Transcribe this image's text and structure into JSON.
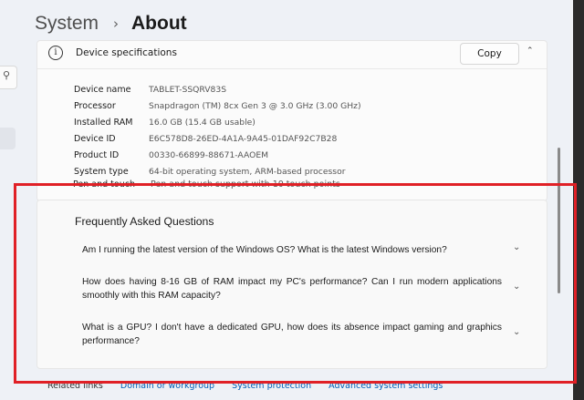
{
  "breadcrumb": {
    "parent": "System",
    "separator": "›",
    "current": "About"
  },
  "sidebar": {
    "search_icon": "search-icon",
    "search_glyph": "⚲"
  },
  "device_specs": {
    "title": "Device specifications",
    "copy_label": "Copy",
    "collapse_glyph": "⌃",
    "rows": [
      {
        "label": "Device name",
        "value": "TABLET-SSQRV83S"
      },
      {
        "label": "Processor",
        "value": "Snapdragon (TM) 8cx Gen 3 @ 3.0 GHz (3.00 GHz)"
      },
      {
        "label": "Installed RAM",
        "value": "16.0 GB (15.4 GB usable)"
      },
      {
        "label": "Device ID",
        "value": "E6C578D8-26ED-4A1A-9A45-01DAF92C7B28"
      },
      {
        "label": "Product ID",
        "value": "00330-66899-88671-AAOEM"
      },
      {
        "label": "System type",
        "value": "64-bit operating system, ARM-based processor"
      }
    ],
    "pen_row": {
      "label": "Pen and touch",
      "value": "Pen and touch support with 10 touch points"
    }
  },
  "faq": {
    "title": "Frequently Asked Questions",
    "chevron_glyph": "⌄",
    "questions": [
      "Am I running the latest version of the Windows OS? What is the latest Windows version?",
      "How does having 8-16 GB of RAM impact my PC's performance? Can I run modern applications smoothly with this RAM capacity?",
      "What is a GPU? I don't have a dedicated GPU, how does its absence impact gaming and graphics performance?"
    ]
  },
  "related": {
    "label": "Related links",
    "links": [
      "Domain or workgroup",
      "System protection",
      "Advanced system settings"
    ]
  },
  "colors": {
    "highlight_border": "#e02026",
    "link": "#005fb8"
  }
}
